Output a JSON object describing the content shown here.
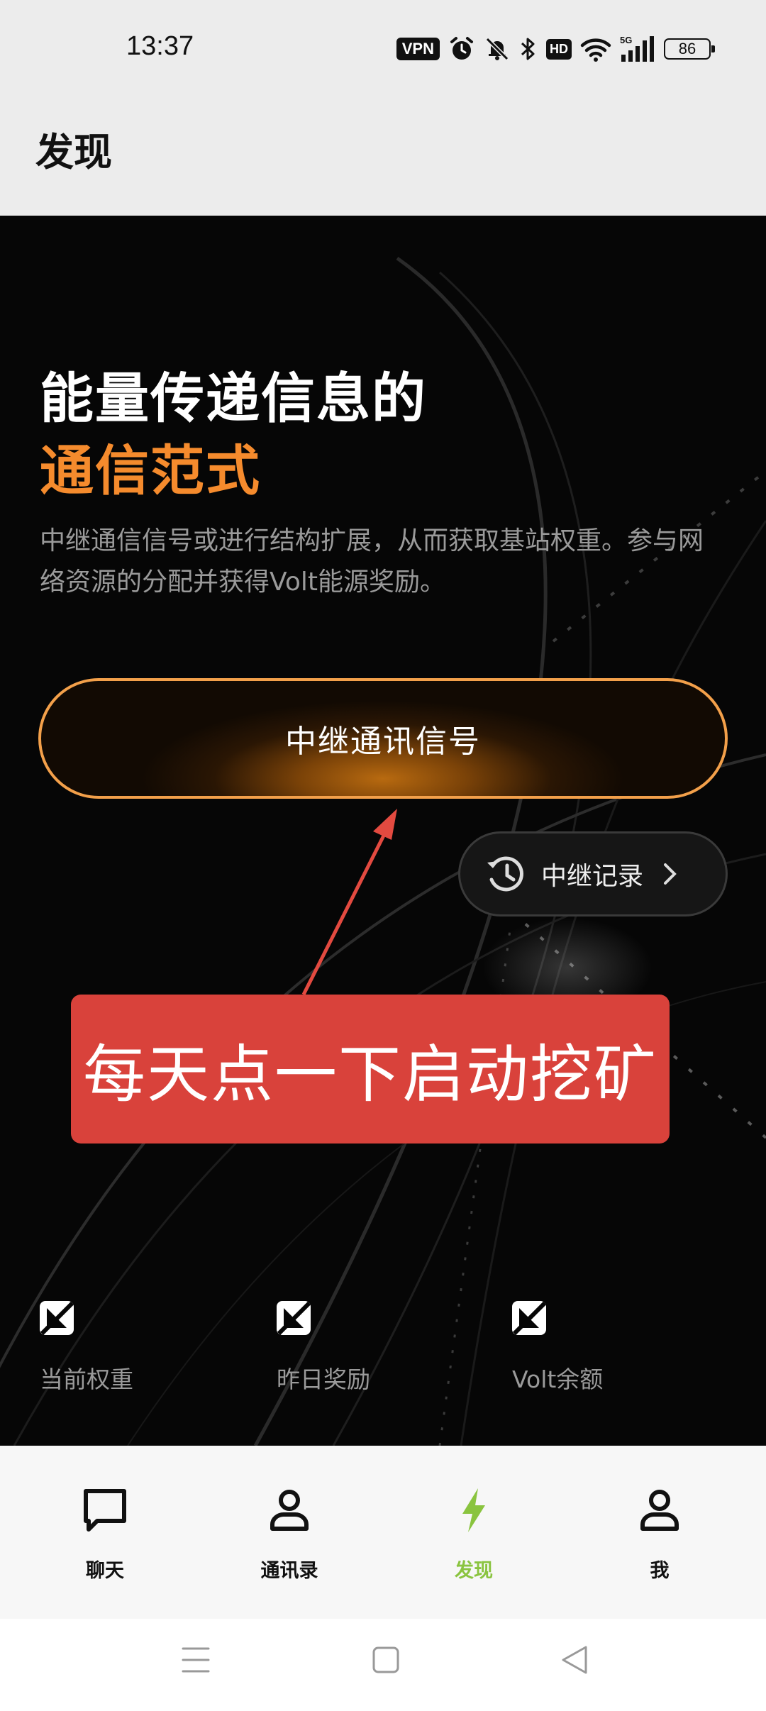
{
  "status_bar": {
    "time": "13:37",
    "vpn": "VPN",
    "hd": "HD",
    "network": "5G",
    "battery": "86"
  },
  "header": {
    "title": "发现"
  },
  "hero": {
    "title_line1": "能量传递信息的",
    "title_line2": "通信范式",
    "description": "中继通信信号或进行结构扩展，从而获取基站权重。参与网络资源的分配并获得Volt能源奖励。",
    "relay_button": "中继通讯信号",
    "record_button": "中继记录",
    "annotation": "每天点一下启动挖矿",
    "accent_color": "#f58b2d",
    "stats": [
      {
        "label": "当前权重"
      },
      {
        "label": "昨日奖励"
      },
      {
        "label": "Volt余额"
      }
    ]
  },
  "bottom_nav": {
    "items": [
      {
        "label": "聊天",
        "icon": "chat-icon"
      },
      {
        "label": "通讯录",
        "icon": "contacts-icon"
      },
      {
        "label": "发现",
        "icon": "lightning-icon",
        "active": true
      },
      {
        "label": "我",
        "icon": "profile-icon"
      }
    ],
    "active_color": "#8ac43f"
  },
  "system_nav": {
    "buttons": [
      "menu-icon",
      "home-icon",
      "back-icon"
    ]
  }
}
